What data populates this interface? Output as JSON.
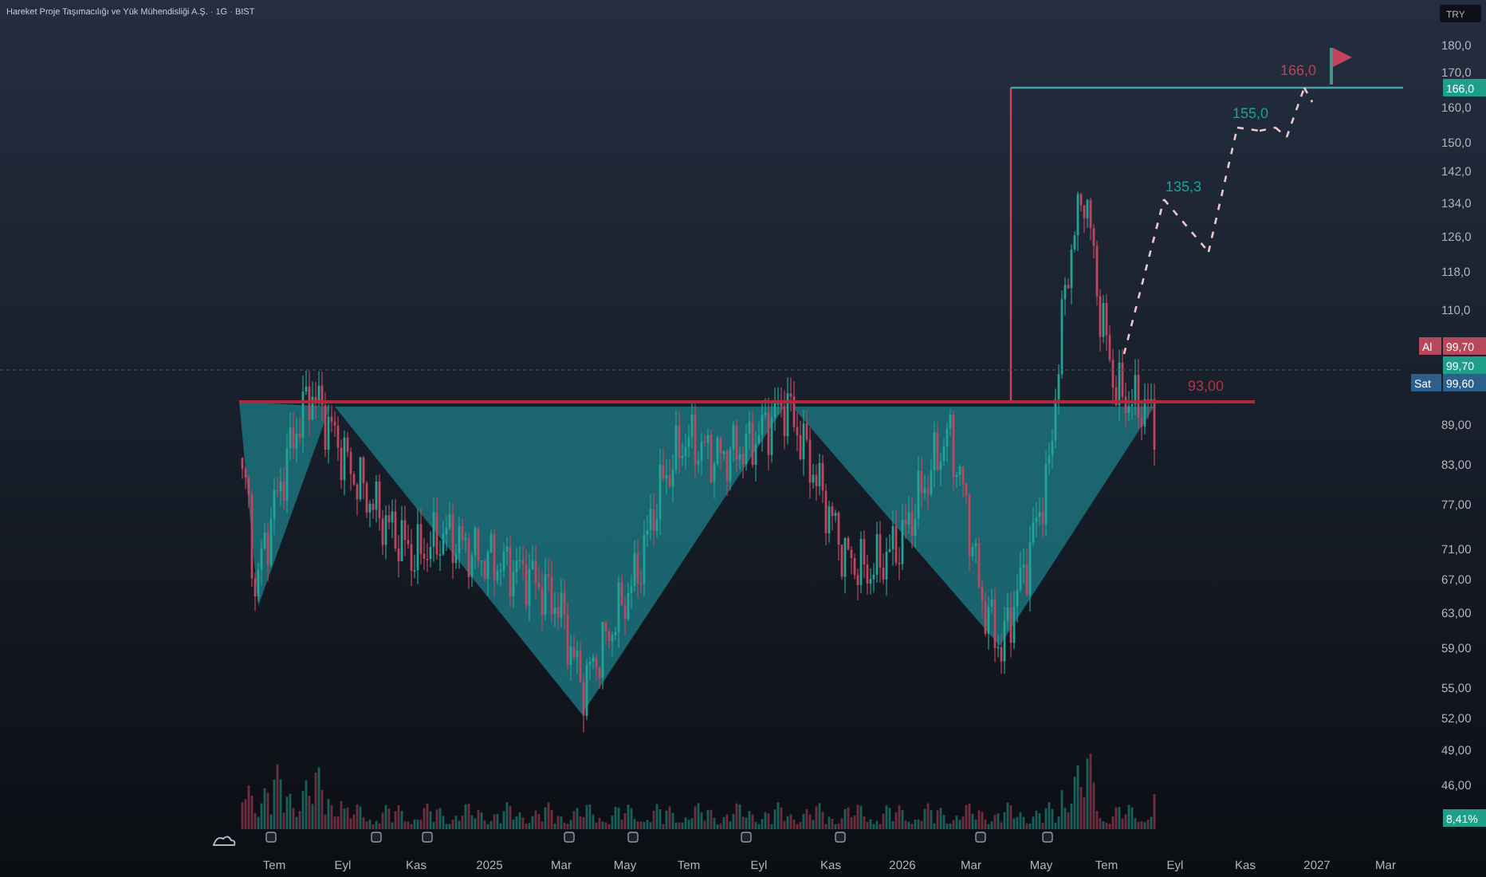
{
  "title": "Hareket Proje Taşımacılığı ve Yük Mühendisliği A.Ş. · 1G · BIST",
  "currency": "TRY",
  "price_axis": {
    "labels": [
      "180,0",
      "170,0",
      "160,0",
      "150,0",
      "142,0",
      "134,0",
      "126,0",
      "118,0",
      "110,0",
      "89,00",
      "83,00",
      "77,00",
      "71,00",
      "67,00",
      "63,00",
      "59,00",
      "55,00",
      "52,00",
      "49,00",
      "46,00"
    ]
  },
  "price_tags": [
    {
      "kind": "target",
      "value": "166,0"
    },
    {
      "kind": "buy",
      "label": "Al",
      "value": "99,70"
    },
    {
      "kind": "last",
      "value": "99,70"
    },
    {
      "kind": "sell",
      "label": "Sat",
      "value": "99,60"
    },
    {
      "kind": "volume",
      "value": "8,41%"
    }
  ],
  "time_axis": {
    "labels": [
      "Tem",
      "Eyl",
      "Kas",
      "2025",
      "Mar",
      "May",
      "Tem",
      "Eyl",
      "Kas",
      "2026",
      "Mar",
      "May",
      "Tem",
      "Eyl",
      "Kas",
      "2027",
      "Mar"
    ]
  },
  "annotations": [
    {
      "kind": "neckline",
      "text": "93,00",
      "color": "#b2364a"
    },
    {
      "kind": "target",
      "text": "135,3",
      "color": "#1aa58f"
    },
    {
      "kind": "target",
      "text": "155,0",
      "color": "#1aa58f"
    },
    {
      "kind": "target",
      "text": "166,0",
      "color": "#b8475c"
    }
  ]
}
